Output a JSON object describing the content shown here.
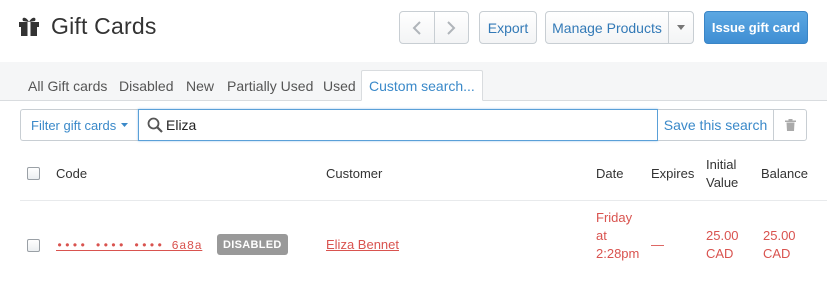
{
  "header": {
    "title": "Gift Cards",
    "icon": "gift-icon",
    "buttons": {
      "export": "Export",
      "manage_products": "Manage Products",
      "issue_gift_card": "Issue gift card"
    }
  },
  "tabs": [
    {
      "label": "All Gift cards",
      "active": false
    },
    {
      "label": "Disabled",
      "active": false
    },
    {
      "label": "New",
      "active": false
    },
    {
      "label": "Partially Used",
      "active": false
    },
    {
      "label": "Used",
      "active": false
    },
    {
      "label": "Custom search...",
      "active": true
    }
  ],
  "filter": {
    "filter_label": "Filter gift cards",
    "search_value": "Eliza",
    "save_search_label": "Save this search"
  },
  "table": {
    "columns": {
      "code": "Code",
      "customer": "Customer",
      "date": "Date",
      "expires": "Expires",
      "initial_value": "Initial Value",
      "balance": "Balance"
    },
    "rows": [
      {
        "code": "•••• •••• •••• 6a8a",
        "status_badge": "DISABLED",
        "customer": "Eliza Bennet",
        "date": "Friday at 2:28pm",
        "expires": "—",
        "initial_value": "25.00 CAD",
        "balance": "25.00 CAD"
      }
    ]
  },
  "colors": {
    "accent": "#3a89c9",
    "primary_button": "#4a9ad9",
    "row_text": "#d9534f",
    "badge": "#999999"
  }
}
